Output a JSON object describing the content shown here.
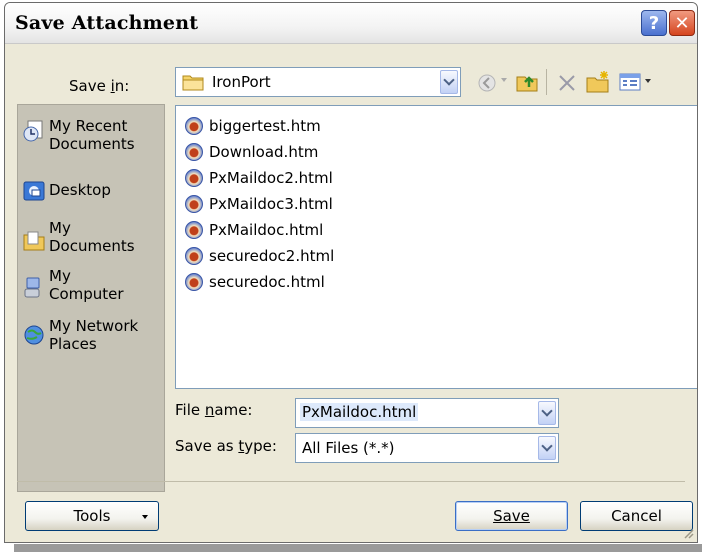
{
  "window": {
    "title": "Save Attachment",
    "help_label": "?",
    "close_label": "✕"
  },
  "save_in": {
    "label": "Save in:",
    "value": "IronPort"
  },
  "places": [
    {
      "label": "My Recent\nDocuments",
      "icon": "recent-documents-icon"
    },
    {
      "label": "Desktop",
      "icon": "desktop-icon"
    },
    {
      "label": "My\nDocuments",
      "icon": "my-documents-icon"
    },
    {
      "label": "My\nComputer",
      "icon": "my-computer-icon"
    },
    {
      "label": "My Network\nPlaces",
      "icon": "network-places-icon"
    }
  ],
  "files": [
    "biggertest.htm",
    "Download.htm",
    "PxMaildoc2.html",
    "PxMaildoc3.html",
    "PxMaildoc.html",
    "securedoc2.html",
    "securedoc.html"
  ],
  "file_name": {
    "label": "File name:",
    "value": "PxMaildoc.html"
  },
  "save_type": {
    "label": "Save as type:",
    "value": "All Files (*.*)"
  },
  "buttons": {
    "tools": "Tools",
    "save": "Save",
    "cancel": "Cancel"
  },
  "colors": {
    "dialog_bg": "#ece9d8",
    "places_bg": "#c6c3b6",
    "selection": "#dde9fb",
    "button_border": "#003c74"
  }
}
